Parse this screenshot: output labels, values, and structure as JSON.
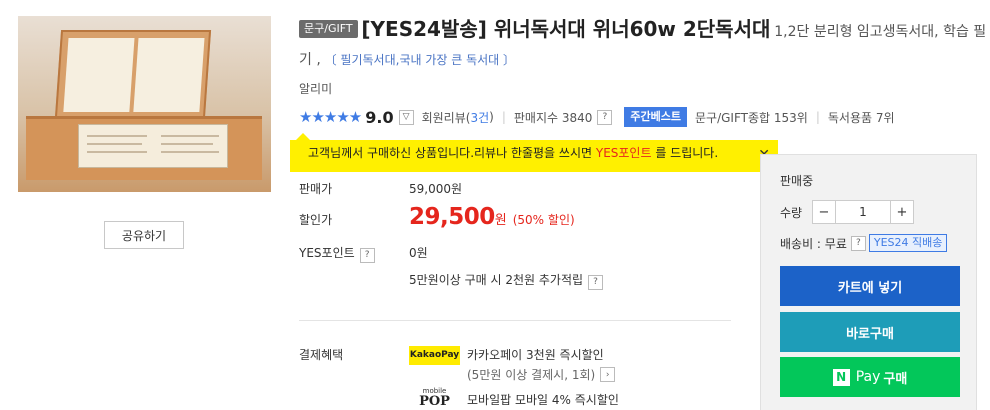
{
  "product": {
    "category_badge": "문구/GIFT",
    "title_main": "[YES24발송] 위너독서대 위너60w 2단독서대",
    "title_sub": "1,2단 분리형 임고생독서대, 학습 필기 ,",
    "title_link": "〔 필기독서대,국내 가장 큰 독서대 〕",
    "publisher": "알리미",
    "share_label": "공유하기"
  },
  "rating": {
    "stars": "★★★★★",
    "score": "9.0",
    "review_label": "회원리뷰(",
    "review_count": "3건",
    "review_close": ")",
    "sales_index_label": "판매지수 3840",
    "best_badge": "주간베스트",
    "rank_1": "문구/GIFT종합 153위",
    "rank_2": "독서용품 7위",
    "select_icon": "chevron-down-icon",
    "help_icon": "question-icon"
  },
  "review_tip": {
    "text_before": "고객님께서 구매하신 상품입니다.리뷰나 한줄평을 쓰시면 ",
    "highlight": "YES포인트",
    "text_after": " 를 드립니다.",
    "close_icon": "close-icon"
  },
  "price": {
    "list_label": "판매가",
    "list_value": "59,000원",
    "sale_label": "할인가",
    "sale_value": "29,500",
    "sale_unit": "원",
    "sale_rate": "(50% 할인)",
    "point_label": "YES포인트",
    "point_value": "0원",
    "point_extra": "5만원이상 구매 시 2천원 추가적립"
  },
  "benefits": {
    "label": "결제혜택",
    "kakao_logo": "KakaoPay",
    "kakao_text": "카카오페이 3천원 즉시할인",
    "kakao_sub": "(5만원 이상 결제시, 1회)",
    "pop_logo_small": "mobile",
    "pop_logo": "POP",
    "pop_text": "모바일팝 모바일 4% 즉시할인"
  },
  "side": {
    "status": "판매중",
    "qty_label": "수량",
    "qty_minus": "−",
    "qty_value": "1",
    "qty_plus": "+",
    "ship_label": "배송비 : 무료",
    "ship_badge": "YES24 직배송",
    "cart_label": "카트에 넣기",
    "buy_label": "바로구매",
    "npay_n": "N",
    "npay_pay": "Pay",
    "npay_label": "구매",
    "colors": {
      "cart": "#1c62c8",
      "buy": "#1e9db8",
      "npay": "#03c75a"
    }
  }
}
